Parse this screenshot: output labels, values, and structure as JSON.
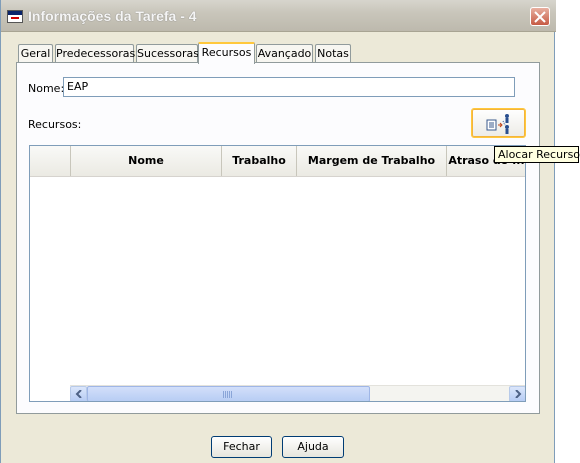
{
  "window": {
    "title": "Informações da Tarefa - 4"
  },
  "tabs": [
    {
      "label": "Geral"
    },
    {
      "label": "Predecessoras"
    },
    {
      "label": "Sucessoras"
    },
    {
      "label": "Recursos",
      "active": true
    },
    {
      "label": "Avançado"
    },
    {
      "label": "Notas"
    }
  ],
  "form": {
    "name_label": "Nome:",
    "name_value": "EAP",
    "resources_label": "Recursos:"
  },
  "allocate_button": {
    "icon": "allocate-resources-icon",
    "tooltip": "Alocar Recursos"
  },
  "table": {
    "columns": [
      "",
      "Nome",
      "Trabalho",
      "Margem de Trabalho",
      "Atraso do ..."
    ],
    "rows": []
  },
  "footer": {
    "close_label": "Fechar",
    "help_label": "Ajuda"
  },
  "colors": {
    "accent": "#ffc83c",
    "close": "#c65a44"
  }
}
